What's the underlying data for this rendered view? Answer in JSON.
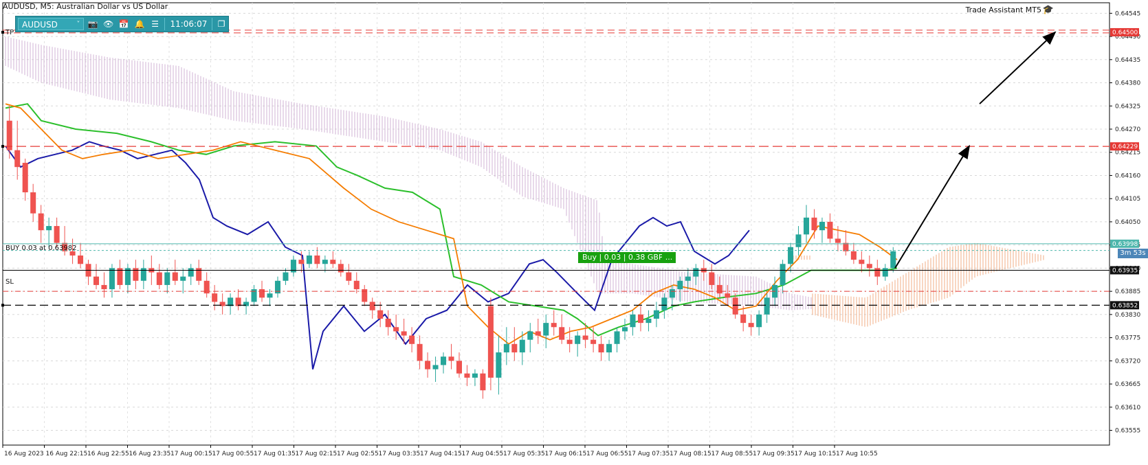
{
  "window": {
    "title": "AUDUSD, M5:  Australian Dollar vs US Dollar",
    "assistant_label": "Trade Assistant MT5",
    "assistant_icon": "graduation-cap-icon"
  },
  "toolbar": {
    "symbol": "AUDUSD",
    "time": "11:06:07",
    "icons": [
      "chevron-down-icon",
      "camera-icon",
      "eye-icon",
      "calendar-icon",
      "bell-icon",
      "menu-icon",
      "window-icon"
    ]
  },
  "labels": {
    "tp": "TP",
    "sl": "SL",
    "buy_order": "BUY 0.03 at 0.63982",
    "buy_trade": "Buy | 0.03 | 0.38 GBP",
    "buy_trade_more": "...",
    "countdown": "3m  53s"
  },
  "price_axis": {
    "ticks": [
      "0.64545",
      "0.64490",
      "0.64435",
      "0.64380",
      "0.64325",
      "0.64270",
      "0.64215",
      "0.64160",
      "0.64105",
      "0.64050",
      "0.63995",
      "0.63940",
      "0.63885",
      "0.63830",
      "0.63775",
      "0.63720",
      "0.63665",
      "0.63610",
      "0.63555"
    ],
    "tags": [
      {
        "text": "0.64500",
        "color": "#e53935"
      },
      {
        "text": "0.64229",
        "color": "#e53935"
      },
      {
        "text": "0.63998",
        "color": "#4db6ac"
      },
      {
        "text": "0.63935",
        "color": "#111111"
      },
      {
        "text": "0.63852",
        "color": "#111111"
      }
    ]
  },
  "time_axis": {
    "ticks": [
      "16 Aug 2023",
      "16 Aug 22:15",
      "16 Aug 22:55",
      "16 Aug 23:35",
      "17 Aug 00:15",
      "17 Aug 00:55",
      "17 Aug 01:35",
      "17 Aug 02:15",
      "17 Aug 02:55",
      "17 Aug 03:35",
      "17 Aug 04:15",
      "17 Aug 04:55",
      "17 Aug 05:35",
      "17 Aug 06:15",
      "17 Aug 06:55",
      "17 Aug 07:35",
      "17 Aug 08:15",
      "17 Aug 08:55",
      "17 Aug 09:35",
      "17 Aug 10:15",
      "17 Aug 10:55"
    ]
  },
  "levels": {
    "tp": 0.645,
    "resistance": 0.64229,
    "buy": 0.63998,
    "buy_open": 0.63982,
    "current": 0.63935,
    "sl": 0.63885,
    "support": 0.63852
  },
  "colors": {
    "bull": "#26a69a",
    "bear": "#ef5350",
    "tenkan": "#1a1aa8",
    "kijun": "#2bbf2b",
    "ma": "#f57c00",
    "cloud_bear": "#c8a0c8",
    "cloud_bull": "#f0a070",
    "tp_line": "#e53935",
    "buy_line": "#4db6ac"
  },
  "chart_data": {
    "type": "candlestick",
    "title": "AUDUSD, M5:  Australian Dollar vs US Dollar",
    "ylim": [
      0.6352,
      0.6457
    ],
    "candles": [
      [
        0.6429,
        0.64325,
        0.642,
        0.6422
      ],
      [
        0.6422,
        0.6429,
        0.6415,
        0.6418
      ],
      [
        0.6419,
        0.642,
        0.641,
        0.6412
      ],
      [
        0.6412,
        0.6414,
        0.6405,
        0.6407
      ],
      [
        0.6407,
        0.6409,
        0.64,
        0.6403
      ],
      [
        0.6403,
        0.6406,
        0.6399,
        0.6404
      ],
      [
        0.6404,
        0.6406,
        0.6399,
        0.64
      ],
      [
        0.64,
        0.6404,
        0.6397,
        0.6398
      ],
      [
        0.6398,
        0.6401,
        0.6395,
        0.6397
      ],
      [
        0.6397,
        0.64,
        0.6394,
        0.6395
      ],
      [
        0.6395,
        0.6396,
        0.639,
        0.6392
      ],
      [
        0.6392,
        0.6395,
        0.6389,
        0.639
      ],
      [
        0.639,
        0.6393,
        0.6387,
        0.6389
      ],
      [
        0.6389,
        0.6395,
        0.6387,
        0.6394
      ],
      [
        0.6394,
        0.6396,
        0.6389,
        0.639
      ],
      [
        0.639,
        0.6395,
        0.6388,
        0.6394
      ],
      [
        0.6394,
        0.6396,
        0.6389,
        0.6391
      ],
      [
        0.6391,
        0.6396,
        0.6389,
        0.6394
      ],
      [
        0.6394,
        0.6397,
        0.639,
        0.6393
      ],
      [
        0.6393,
        0.6395,
        0.6389,
        0.639
      ],
      [
        0.639,
        0.6394,
        0.6388,
        0.6393
      ],
      [
        0.6393,
        0.6396,
        0.639,
        0.6391
      ],
      [
        0.6391,
        0.6394,
        0.6388,
        0.6392
      ],
      [
        0.6392,
        0.6395,
        0.639,
        0.6394
      ],
      [
        0.6394,
        0.6396,
        0.639,
        0.6391
      ],
      [
        0.6391,
        0.6393,
        0.6387,
        0.6388
      ],
      [
        0.6388,
        0.639,
        0.6384,
        0.6386
      ],
      [
        0.6386,
        0.6388,
        0.6383,
        0.6385
      ],
      [
        0.6385,
        0.6388,
        0.6383,
        0.6387
      ],
      [
        0.6387,
        0.6389,
        0.6384,
        0.6385
      ],
      [
        0.6385,
        0.6387,
        0.6383,
        0.6386
      ],
      [
        0.6386,
        0.639,
        0.6385,
        0.6389
      ],
      [
        0.6389,
        0.6391,
        0.6386,
        0.6387
      ],
      [
        0.6387,
        0.6389,
        0.6385,
        0.6388
      ],
      [
        0.6388,
        0.6392,
        0.6387,
        0.6391
      ],
      [
        0.6391,
        0.6394,
        0.639,
        0.6393
      ],
      [
        0.6393,
        0.6397,
        0.6392,
        0.6396
      ],
      [
        0.6396,
        0.6398,
        0.6393,
        0.6395
      ],
      [
        0.6395,
        0.6398,
        0.6394,
        0.6397
      ],
      [
        0.6397,
        0.6399,
        0.6394,
        0.6395
      ],
      [
        0.6395,
        0.6397,
        0.6393,
        0.6396
      ],
      [
        0.6396,
        0.6398,
        0.6394,
        0.6395
      ],
      [
        0.6395,
        0.6396,
        0.6392,
        0.6393
      ],
      [
        0.6393,
        0.6395,
        0.639,
        0.6391
      ],
      [
        0.6391,
        0.6393,
        0.6388,
        0.6389
      ],
      [
        0.6389,
        0.639,
        0.6385,
        0.6386
      ],
      [
        0.6386,
        0.6387,
        0.6382,
        0.6384
      ],
      [
        0.6384,
        0.6386,
        0.638,
        0.6382
      ],
      [
        0.6382,
        0.6384,
        0.6378,
        0.638
      ],
      [
        0.638,
        0.6383,
        0.6377,
        0.6379
      ],
      [
        0.6379,
        0.6382,
        0.6376,
        0.6378
      ],
      [
        0.6378,
        0.638,
        0.6374,
        0.6376
      ],
      [
        0.6376,
        0.6378,
        0.637,
        0.6372
      ],
      [
        0.6372,
        0.6374,
        0.6368,
        0.637
      ],
      [
        0.637,
        0.6373,
        0.6367,
        0.6371
      ],
      [
        0.6371,
        0.6374,
        0.6369,
        0.6373
      ],
      [
        0.6373,
        0.6376,
        0.637,
        0.6372
      ],
      [
        0.6372,
        0.6374,
        0.6368,
        0.6369
      ],
      [
        0.6369,
        0.6371,
        0.6366,
        0.6368
      ],
      [
        0.6368,
        0.637,
        0.6366,
        0.6369
      ],
      [
        0.6369,
        0.637,
        0.6363,
        0.6365
      ],
      [
        0.6385,
        0.6387,
        0.6365,
        0.6368
      ],
      [
        0.6368,
        0.6378,
        0.6364,
        0.6374
      ],
      [
        0.6374,
        0.638,
        0.6371,
        0.6376
      ],
      [
        0.6376,
        0.638,
        0.6372,
        0.6374
      ],
      [
        0.6374,
        0.6379,
        0.6371,
        0.6377
      ],
      [
        0.6377,
        0.6381,
        0.6374,
        0.6379
      ],
      [
        0.6379,
        0.6382,
        0.6376,
        0.6378
      ],
      [
        0.6378,
        0.6383,
        0.6375,
        0.6381
      ],
      [
        0.6381,
        0.6384,
        0.6378,
        0.638
      ],
      [
        0.638,
        0.6383,
        0.6376,
        0.6377
      ],
      [
        0.6377,
        0.638,
        0.6374,
        0.6376
      ],
      [
        0.6376,
        0.6379,
        0.6373,
        0.6378
      ],
      [
        0.6378,
        0.6381,
        0.6375,
        0.6377
      ],
      [
        0.6377,
        0.638,
        0.6374,
        0.6376
      ],
      [
        0.6376,
        0.6378,
        0.6372,
        0.6374
      ],
      [
        0.6374,
        0.6377,
        0.6372,
        0.6376
      ],
      [
        0.6376,
        0.638,
        0.6374,
        0.6379
      ],
      [
        0.6379,
        0.6382,
        0.6377,
        0.638
      ],
      [
        0.638,
        0.6384,
        0.6378,
        0.6383
      ],
      [
        0.6383,
        0.6385,
        0.6379,
        0.6381
      ],
      [
        0.6381,
        0.6384,
        0.6379,
        0.6382
      ],
      [
        0.6382,
        0.6386,
        0.638,
        0.6384
      ],
      [
        0.6384,
        0.6388,
        0.6382,
        0.6387
      ],
      [
        0.6387,
        0.639,
        0.6384,
        0.6389
      ],
      [
        0.6389,
        0.6392,
        0.6386,
        0.6391
      ],
      [
        0.6391,
        0.6394,
        0.6389,
        0.6392
      ],
      [
        0.6392,
        0.6395,
        0.639,
        0.6394
      ],
      [
        0.6394,
        0.6396,
        0.6391,
        0.6393
      ],
      [
        0.6393,
        0.6395,
        0.6389,
        0.639
      ],
      [
        0.639,
        0.6392,
        0.6387,
        0.6388
      ],
      [
        0.6388,
        0.639,
        0.6385,
        0.6387
      ],
      [
        0.6387,
        0.6388,
        0.6382,
        0.6383
      ],
      [
        0.6383,
        0.6385,
        0.6379,
        0.6381
      ],
      [
        0.6381,
        0.6383,
        0.6378,
        0.638
      ],
      [
        0.638,
        0.6384,
        0.6378,
        0.6383
      ],
      [
        0.6383,
        0.6388,
        0.6381,
        0.6387
      ],
      [
        0.6387,
        0.6392,
        0.6385,
        0.639
      ],
      [
        0.639,
        0.6396,
        0.6388,
        0.6395
      ],
      [
        0.6395,
        0.64,
        0.6393,
        0.6399
      ],
      [
        0.6399,
        0.6404,
        0.6397,
        0.6402
      ],
      [
        0.6402,
        0.6409,
        0.64,
        0.6406
      ],
      [
        0.6406,
        0.6408,
        0.6401,
        0.6403
      ],
      [
        0.6403,
        0.6406,
        0.64,
        0.6405
      ],
      [
        0.6405,
        0.6407,
        0.64,
        0.6401
      ],
      [
        0.6401,
        0.6404,
        0.6398,
        0.64
      ],
      [
        0.64,
        0.6403,
        0.6397,
        0.6398
      ],
      [
        0.6398,
        0.64,
        0.6395,
        0.6396
      ],
      [
        0.6396,
        0.6398,
        0.6393,
        0.6395
      ],
      [
        0.6395,
        0.6397,
        0.6392,
        0.6394
      ],
      [
        0.6394,
        0.6396,
        0.639,
        0.6392
      ],
      [
        0.6392,
        0.6395,
        0.6391,
        0.6394
      ],
      [
        0.6394,
        0.6399,
        0.6393,
        0.6398
      ]
    ]
  }
}
